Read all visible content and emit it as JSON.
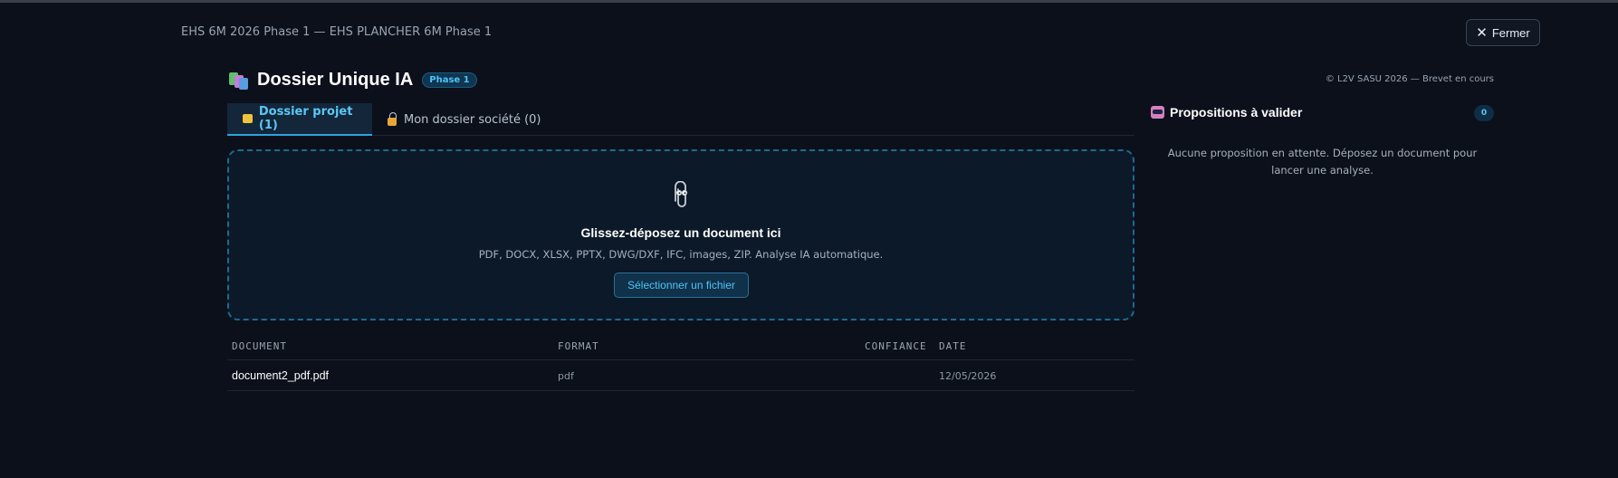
{
  "header": {
    "breadcrumb": "EHS 6M 2026 Phase 1 — EHS PLANCHER 6M Phase 1",
    "close_label": "Fermer",
    "close_icon": "close-icon"
  },
  "app": {
    "title": "Dossier Unique IA",
    "phase_badge": "Phase 1",
    "copyright": "© L2V SASU 2026 — Brevet en cours"
  },
  "tabs": [
    {
      "label": "Dossier projet (1)",
      "icon": "folder-icon",
      "active": true
    },
    {
      "label": "Mon dossier société (0)",
      "icon": "lock-icon",
      "active": false
    }
  ],
  "dropzone": {
    "icon": "paperclip-icon",
    "title": "Glissez-déposez un document ici",
    "subtitle": "PDF, DOCX, XLSX, PPTX, DWG/DXF, IFC, images, ZIP. Analyse IA automatique.",
    "button_label": "Sélectionner un fichier"
  },
  "table": {
    "headers": [
      "DOCUMENT",
      "FORMAT",
      "CONFIANCE",
      "DATE"
    ],
    "rows": [
      {
        "document": "document2_pdf.pdf",
        "format": "pdf",
        "confiance": "",
        "date": "12/05/2026"
      }
    ]
  },
  "sidebar": {
    "title": "Propositions à valider",
    "icon": "robot-icon",
    "count": "0",
    "empty_text": "Aucune proposition en attente. Déposez un document pour lancer une analyse."
  },
  "colors": {
    "background": "#0b101b",
    "accent": "#4fc3f7",
    "dropzone_border": "#1e6a8f"
  }
}
